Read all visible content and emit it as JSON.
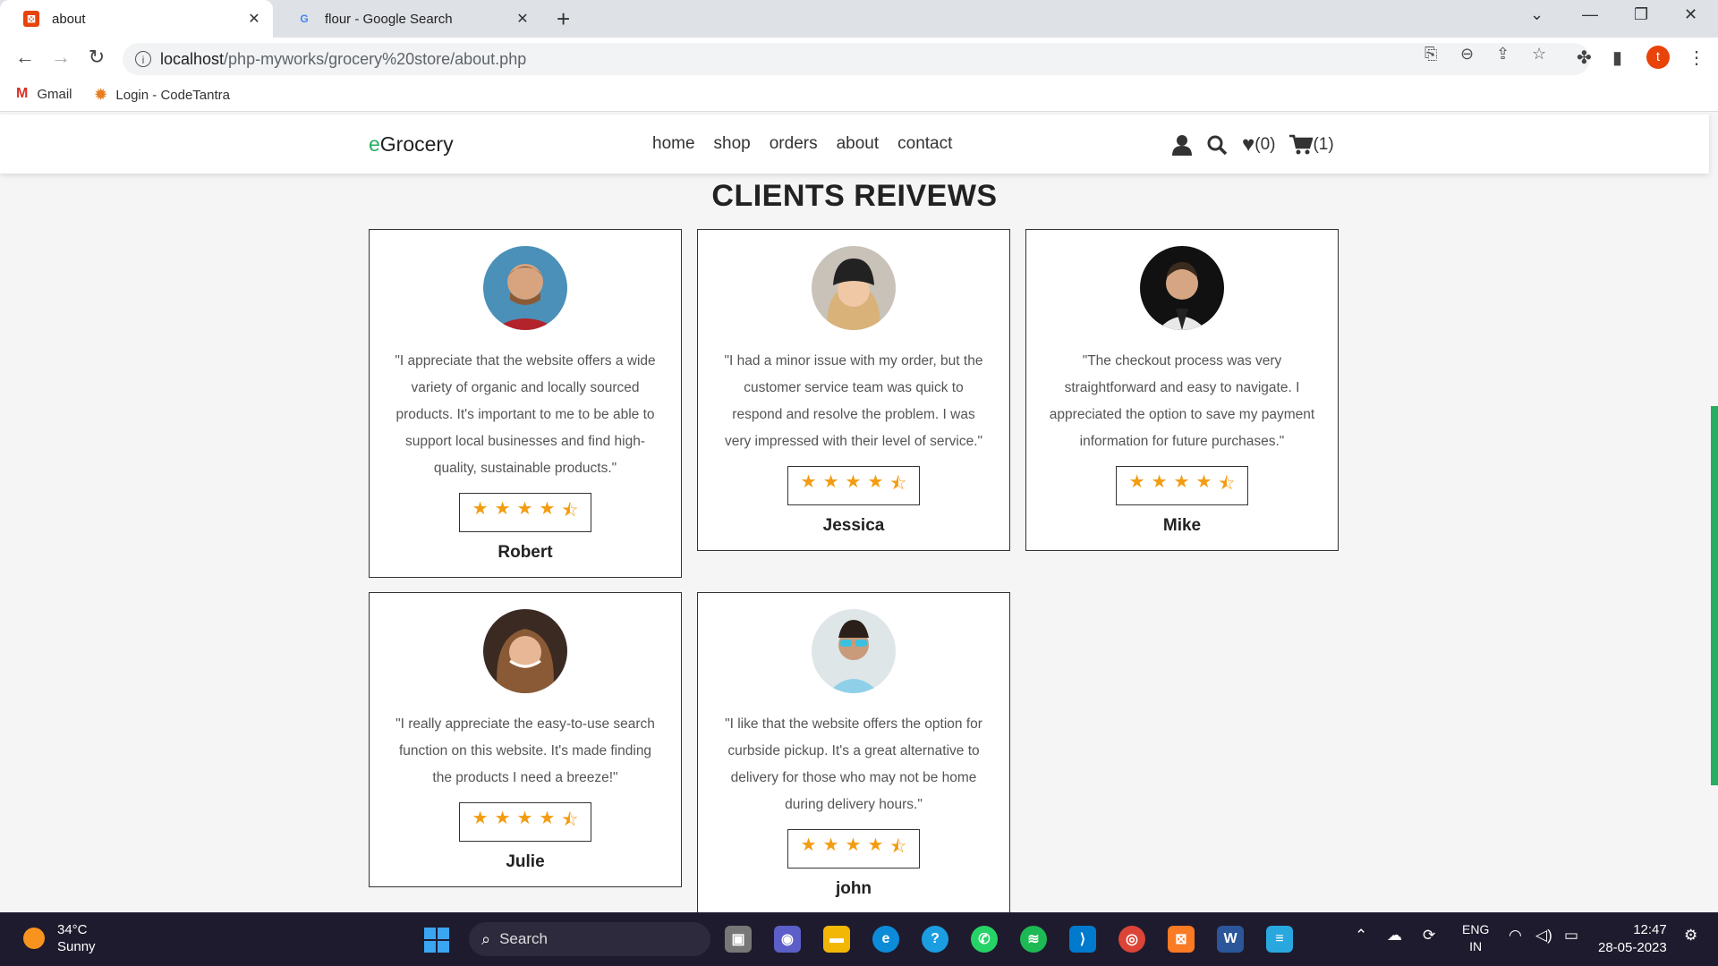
{
  "browser": {
    "tabs": [
      {
        "title": "about",
        "active": true
      },
      {
        "title": "flour - Google Search",
        "active": false
      }
    ],
    "url_host": "localhost",
    "url_path": "/php-myworks/grocery%20store/about.php",
    "profile_initial": "t",
    "bookmarks": [
      "Gmail",
      "Login - CodeTantra"
    ]
  },
  "site": {
    "logo_prefix": "e",
    "logo_rest": "Grocery",
    "nav": [
      "home",
      "shop",
      "orders",
      "about",
      "contact"
    ],
    "wishlist_count": "(0)",
    "cart_count": "(1)"
  },
  "section_title": "CLIENTS REIVEWS",
  "rating": 4.5,
  "reviews": [
    {
      "name": "Robert",
      "quote": "\"I appreciate that the website offers a wide variety of organic and locally sourced products. It's important to me to be able to support local businesses and find high-quality, sustainable products.\"",
      "rating": 4.5
    },
    {
      "name": "Jessica",
      "quote": "\"I had a minor issue with my order, but the customer service team was quick to respond and resolve the problem. I was very impressed with their level of service.\"",
      "rating": 4.5
    },
    {
      "name": "Mike",
      "quote": "\"The checkout process was very straightforward and easy to navigate. I appreciated the option to save my payment information for future purchases.\"",
      "rating": 4.5
    },
    {
      "name": "Julie",
      "quote": "\"I really appreciate the easy-to-use search function on this website. It's made finding the products I need a breeze!\"",
      "rating": 4.5
    },
    {
      "name": "john",
      "quote": "\"I like that the website offers the option for curbside pickup. It's a great alternative to delivery for those who may not be home during delivery hours.\"",
      "rating": 4.5
    }
  ],
  "taskbar": {
    "temperature": "34°C",
    "weather": "Sunny",
    "search_label": "Search",
    "lang_top": "ENG",
    "lang_bottom": "IN",
    "time": "12:47",
    "date": "28-05-2023"
  },
  "colors": {
    "brand": "#27ae60",
    "star": "#f39c12"
  }
}
